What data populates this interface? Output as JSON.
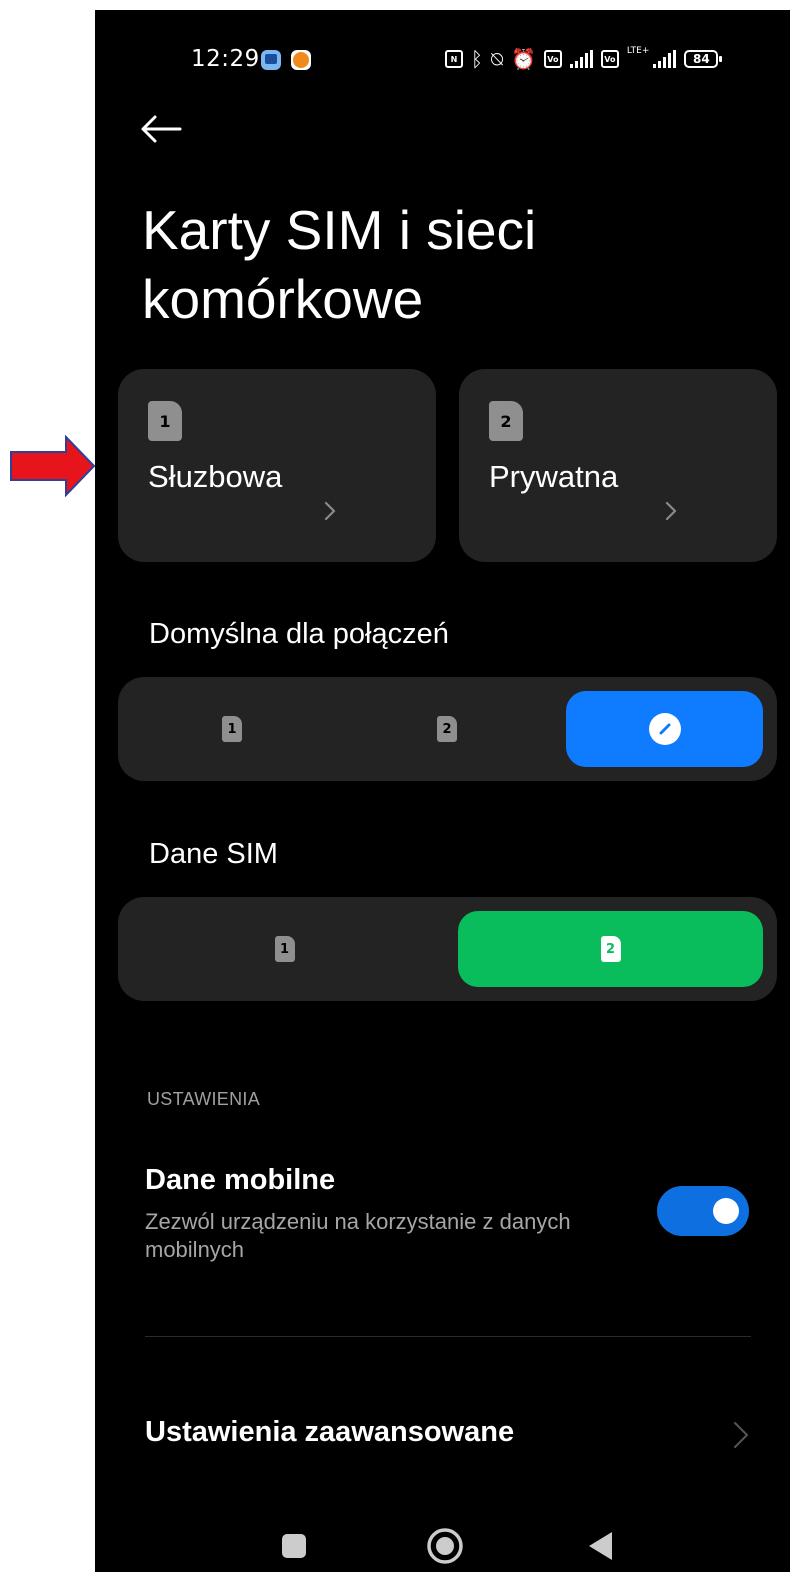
{
  "status_bar": {
    "time": "12:29",
    "battery": "84"
  },
  "page_title": "Karty SIM i sieci komórkowe",
  "sim_cards": [
    {
      "slot": "1",
      "name": "Słuzbowa"
    },
    {
      "slot": "2",
      "name": "Prywatna"
    }
  ],
  "default_calls": {
    "label": "Domyślna dla połączeń",
    "options": [
      "1",
      "2"
    ],
    "selected": "ask"
  },
  "sim_data": {
    "label": "Dane SIM",
    "options": [
      "1",
      "2"
    ],
    "selected": "2"
  },
  "settings": {
    "header": "USTAWIENIA",
    "mobile_data": {
      "title": "Dane mobilne",
      "subtitle": "Zezwól urządzeniu na korzystanie z danych mobilnych",
      "enabled": true
    },
    "advanced": {
      "title": "Ustawienia zaawansowane"
    }
  },
  "colors": {
    "background": "#000000",
    "card": "#232323",
    "accent_blue": "#0f7bff",
    "accent_green": "#09bc5c",
    "toggle_on": "#0d6fe0",
    "annotation_arrow": "#e8141b"
  },
  "icons": [
    "back-arrow-icon",
    "sim-1-icon",
    "sim-2-icon",
    "chevron-right-icon",
    "edit-pencil-icon",
    "recents-square-icon",
    "home-circle-icon",
    "back-triangle-icon"
  ]
}
